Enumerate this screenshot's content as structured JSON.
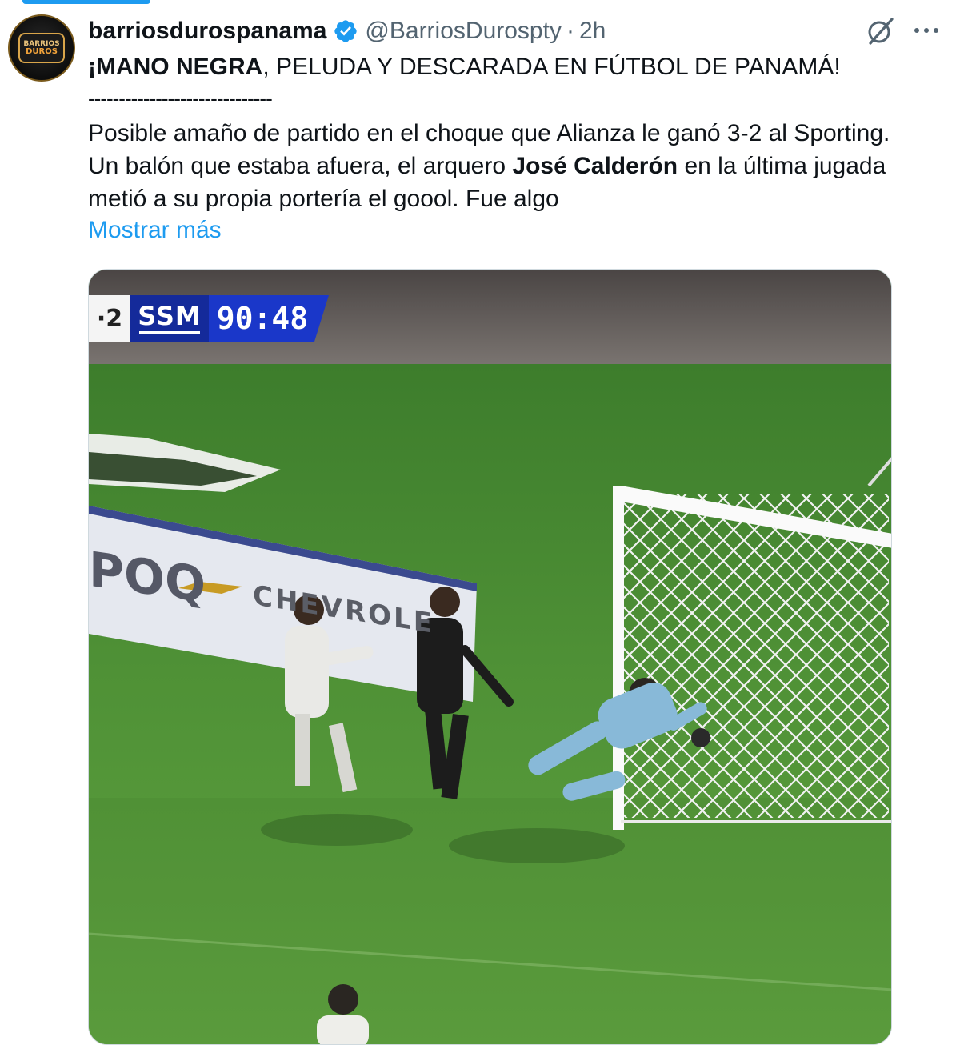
{
  "author": {
    "display_name": "barriosdurospanama",
    "handle": "@BarriosDurospty",
    "separator": "·",
    "time": "2h",
    "avatar_text_top": "BARRIOS",
    "avatar_text_bottom": "DUROS"
  },
  "post": {
    "title_bold": "¡MANO NEGRA",
    "title_rest": ", PELUDA Y DESCARADA EN FÚTBOL DE PANAMÁ!",
    "divider": "------------------------------",
    "line1": "Posible amaño de partido en el choque que Alianza le ganó 3-2 al Sporting.",
    "line2_a": "Un balón que estaba afuera, el arquero ",
    "line2_bold": "José Calderón",
    "line2_b": " en la última jugada",
    "line3": "metió a su propia portería el goool. Fue algo",
    "show_more": "Mostrar más"
  },
  "media": {
    "scorebug": {
      "prev_score": "·2",
      "team": "SSM",
      "clock": "90:48"
    },
    "board_text_1": "POQ",
    "board_text_2": "CHEVROLE"
  },
  "icons": {
    "verified": "verified-badge-icon",
    "grok": "grok-icon",
    "more": "more-options-icon"
  },
  "colors": {
    "accent": "#1d9bf0",
    "secondary_text": "#536471",
    "scorebug_blue": "#1a37c9"
  }
}
